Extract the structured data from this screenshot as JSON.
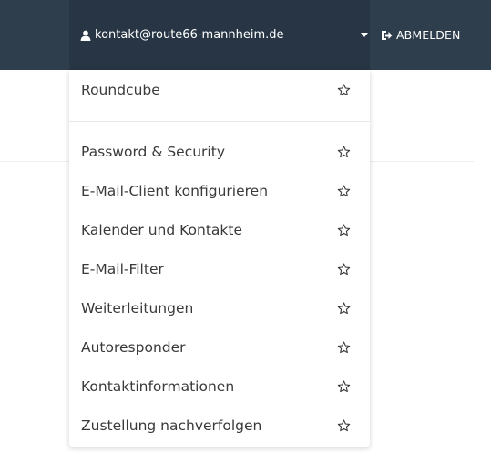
{
  "header": {
    "user_email": "kontakt@route66-mannheim.de",
    "logout_label": "ABMELDEN",
    "icons": {
      "user": "user-icon",
      "caret": "caret-down-icon",
      "logout": "sign-out-icon"
    },
    "colors": {
      "bar_bg": "#2f3e4d",
      "active_bg": "#273544",
      "text": "#ffffff"
    }
  },
  "dropdown": {
    "primary_items": [
      {
        "label": "Roundcube",
        "icon": "star-outline-icon"
      }
    ],
    "secondary_items": [
      {
        "label": "Password & Security",
        "icon": "star-outline-icon"
      },
      {
        "label": "E-Mail-Client konfigurieren",
        "icon": "star-outline-icon"
      },
      {
        "label": "Kalender und Kontakte",
        "icon": "star-outline-icon"
      },
      {
        "label": "E-Mail-Filter",
        "icon": "star-outline-icon"
      },
      {
        "label": "Weiterleitungen",
        "icon": "star-outline-icon"
      },
      {
        "label": "Autoresponder",
        "icon": "star-outline-icon"
      },
      {
        "label": "Kontaktinformationen",
        "icon": "star-outline-icon"
      },
      {
        "label": "Zustellung nachverfolgen",
        "icon": "star-outline-icon"
      }
    ],
    "colors": {
      "item_text": "#3a3a3a",
      "star_outline": "#3a3a3a",
      "separator": "#e6e8eb"
    }
  }
}
